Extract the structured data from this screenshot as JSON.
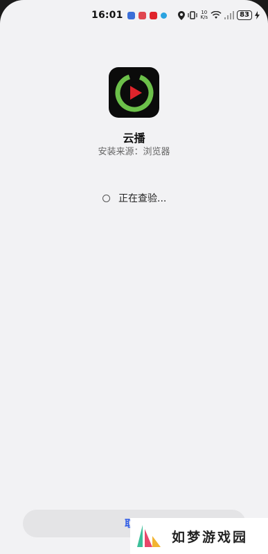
{
  "status_bar": {
    "time": "16:01",
    "net_speed_top": "10",
    "net_speed_bottom": "K/s",
    "battery": "83",
    "notif_colors": [
      "#3b6fd8",
      "#e0464f",
      "#e0232b",
      "#2aa3e0"
    ]
  },
  "app": {
    "name": "云播",
    "source_label": "安装来源：",
    "source_value": "浏览器",
    "icon": "play-ring-icon"
  },
  "verify": {
    "text": "正在查验..."
  },
  "actions": {
    "cancel_label": "取消"
  },
  "watermark": {
    "text": "如梦游戏园"
  },
  "colors": {
    "background": "#f2f2f4",
    "accent": "#2e5be6",
    "icon_green": "#6cc04a",
    "icon_red": "#e0232b"
  }
}
